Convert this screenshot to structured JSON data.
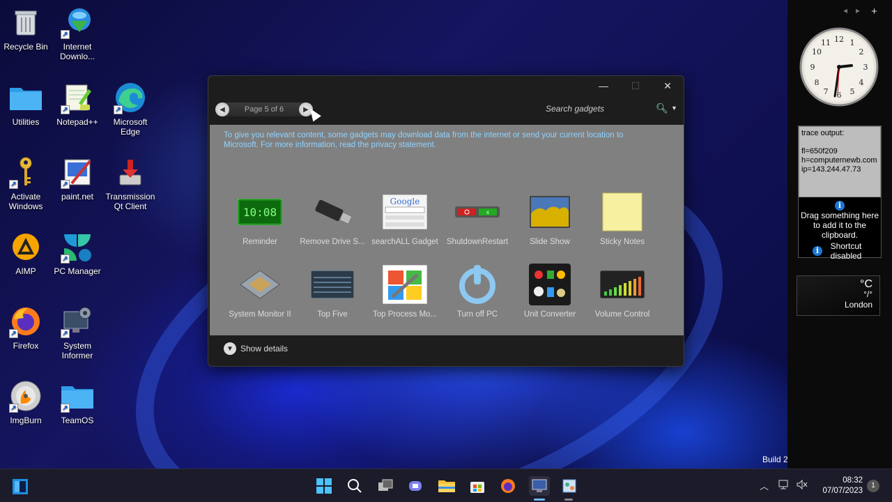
{
  "desktop": {
    "icons": [
      {
        "label": "Recycle Bin",
        "icon": "recycle-bin-icon"
      },
      {
        "label": "Internet Downlo...",
        "icon": "idm-icon"
      },
      {
        "label": "Utilities",
        "icon": "folder-icon"
      },
      {
        "label": "Notepad++",
        "icon": "notepadpp-icon"
      },
      {
        "label": "Microsoft Edge",
        "icon": "edge-icon"
      },
      {
        "label": "Activate Windows",
        "icon": "key-icon"
      },
      {
        "label": "paint.net",
        "icon": "paintnet-icon"
      },
      {
        "label": "Transmission Qt Client",
        "icon": "transmission-icon"
      },
      {
        "label": "AIMP",
        "icon": "aimp-icon"
      },
      {
        "label": "PC Manager",
        "icon": "pc-manager-icon"
      },
      {
        "label": "Firefox",
        "icon": "firefox-icon"
      },
      {
        "label": "System Informer",
        "icon": "system-informer-icon"
      },
      {
        "label": "ImgBurn",
        "icon": "imgburn-icon"
      },
      {
        "label": "TeamOS",
        "icon": "folder-icon"
      }
    ],
    "build_text": "Build 2"
  },
  "sidebar": {
    "clipboard": {
      "trace_title": "trace output:",
      "trace_lines": [
        "fl=650f209",
        "h=computernewb.com",
        "ip=143.244.47.73"
      ],
      "drag_text": "Drag something here to add it to the clipboard.",
      "shortcut_text": "Shortcut disabled"
    },
    "weather": {
      "temp": "°C",
      "range": "°/°",
      "city": "London"
    }
  },
  "gadgets_window": {
    "pager_text": "Page 5 of 6",
    "search_placeholder": "Search gadgets",
    "notice": "To give you relevant content, some gadgets may download data from the internet or send your current location to Microsoft. For more information, read the privacy statement.",
    "tiles": [
      {
        "label": "Reminder",
        "icon": "reminder-icon"
      },
      {
        "label": "Remove Drive S...",
        "icon": "usb-drive-icon"
      },
      {
        "label": "searchALL Gadget",
        "icon": "google-search-icon"
      },
      {
        "label": "ShutdownRestart",
        "icon": "shutdown-restart-icon"
      },
      {
        "label": "Slide Show",
        "icon": "slideshow-icon"
      },
      {
        "label": "Sticky Notes",
        "icon": "sticky-note-icon"
      },
      {
        "label": "System Monitor II",
        "icon": "cpu-icon"
      },
      {
        "label": "Top Five",
        "icon": "top-five-icon"
      },
      {
        "label": "Top Process Mo...",
        "icon": "top-process-icon"
      },
      {
        "label": "Turn off PC",
        "icon": "power-icon"
      },
      {
        "label": "Unit Converter",
        "icon": "unit-converter-icon"
      },
      {
        "label": "Volume Control",
        "icon": "volume-control-icon"
      }
    ],
    "reminder_time": "10:08",
    "show_details": "Show details"
  },
  "taskbar": {
    "time": "08:32",
    "date": "07/07/2023",
    "notification_count": "1"
  },
  "colors": {
    "accent": "#0078d4",
    "gallery_bg": "#808080",
    "notice_text": "#8fd3ff"
  }
}
